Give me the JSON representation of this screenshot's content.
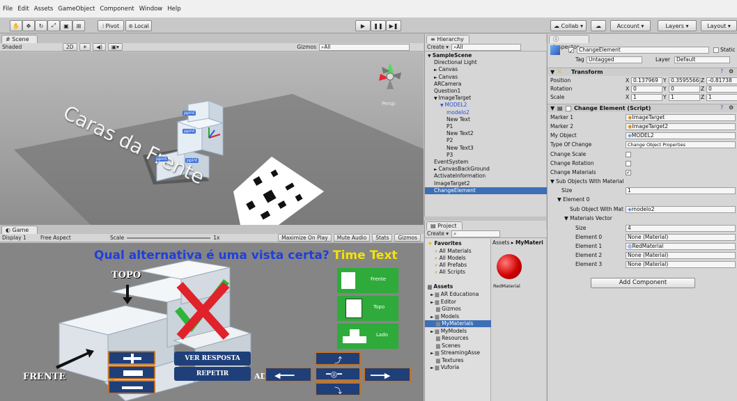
{
  "menu": [
    "File",
    "Edit",
    "Assets",
    "GameObject",
    "Component",
    "Window",
    "Help"
  ],
  "toolbar": {
    "pivot": "Pivot",
    "local": "Local",
    "collab": "Collab",
    "account": "Account",
    "layers": "Layers",
    "layout": "Layout"
  },
  "scene": {
    "tab": "Scene",
    "shading": "Shaded",
    "mode2d": "2D",
    "gizmos": "Gizmos",
    "search": "All",
    "persp": "Persp",
    "world_text": "Caras da Frente",
    "labels": [
      "ppint",
      "ppint",
      "ppint",
      "ppint"
    ]
  },
  "game": {
    "tab": "Game",
    "display": "Display 1",
    "aspect": "Free Aspect",
    "scale_label": "Scale",
    "scale_value": "1x",
    "options": [
      "Maximize On Play",
      "Mute Audio",
      "Stats",
      "Gizmos"
    ],
    "question": "Qual alternativa é uma vista certa?",
    "timer": "Time Text",
    "topo": "TOPO",
    "frente": "FRENTE",
    "partial_label": "AD",
    "ver_resposta": "VER RESPOSTA",
    "repetir": "REPETIR",
    "options_side": [
      "Frente",
      "Topo",
      "Lado"
    ]
  },
  "hierarchy": {
    "tab": "Hierarchy",
    "create": "Create",
    "search": "All",
    "items": [
      {
        "label": "SampleScene",
        "indent": 0,
        "bold": true,
        "arrow": "▼"
      },
      {
        "label": "Directional Light",
        "indent": 1
      },
      {
        "label": "Canvas",
        "indent": 1,
        "arrow": "►"
      },
      {
        "label": "Canvas",
        "indent": 1,
        "arrow": "►"
      },
      {
        "label": "ARCamera",
        "indent": 1
      },
      {
        "label": "Question1",
        "indent": 1
      },
      {
        "label": "ImageTarget",
        "indent": 1,
        "arrow": "▼"
      },
      {
        "label": "MODEL2",
        "indent": 2,
        "arrow": "▼",
        "blue": true
      },
      {
        "label": "modelo2",
        "indent": 3,
        "blue": true
      },
      {
        "label": "New Text",
        "indent": 3
      },
      {
        "label": "P1",
        "indent": 3
      },
      {
        "label": "New Text2",
        "indent": 3
      },
      {
        "label": "P2",
        "indent": 3
      },
      {
        "label": "New Text3",
        "indent": 3
      },
      {
        "label": "P3",
        "indent": 3
      },
      {
        "label": "EventSystem",
        "indent": 1
      },
      {
        "label": "CanvasBackGround",
        "indent": 1,
        "arrow": "►"
      },
      {
        "label": "ActivateInformation",
        "indent": 1
      },
      {
        "label": "ImageTarget2",
        "indent": 1
      },
      {
        "label": "ChangeElement",
        "indent": 1,
        "selected": true
      }
    ]
  },
  "project": {
    "tab": "Project",
    "create": "Create",
    "breadcrumb": [
      "Assets",
      "MyMateri"
    ],
    "favorites_label": "Favorites",
    "favorites": [
      "All Materials",
      "All Models",
      "All Prefabs",
      "All Scripts"
    ],
    "assets_label": "Assets",
    "folders": [
      {
        "label": "AR Educationa",
        "arrow": true
      },
      {
        "label": "Editor",
        "arrow": true
      },
      {
        "label": "Gizmos",
        "arrow": false
      },
      {
        "label": "Models",
        "arrow": true
      },
      {
        "label": "MyMaterials",
        "arrow": false,
        "selected": true
      },
      {
        "label": "MyModels",
        "arrow": true
      },
      {
        "label": "Resources",
        "arrow": false
      },
      {
        "label": "Scenes",
        "arrow": false
      },
      {
        "label": "StreamingAsse",
        "arrow": true
      },
      {
        "label": "Textures",
        "arrow": false
      },
      {
        "label": "Vuforia",
        "arrow": true
      }
    ],
    "asset_name": "RedMaterial"
  },
  "inspector": {
    "tab": "Inspector",
    "object_name": "ChangeElement",
    "static_label": "Static",
    "tag_label": "Tag",
    "tag": "Untagged",
    "layer_label": "Layer",
    "layer": "Default",
    "transform": {
      "title": "Transform",
      "position_label": "Position",
      "rotation_label": "Rotation",
      "scale_label": "Scale",
      "position": [
        "0.137969",
        "0.3595566",
        "-0.81738"
      ],
      "rotation": [
        "0",
        "0",
        "0"
      ],
      "scale": [
        "1",
        "1",
        "1"
      ]
    },
    "script": {
      "title": "Change Element (Script)",
      "marker1_label": "Marker 1",
      "marker1": "ImageTarget",
      "marker2_label": "Marker 2",
      "marker2": "ImageTarget2",
      "myobject_label": "My Object",
      "myobject": "MODEL2",
      "type_label": "Type Of Change",
      "type": "Change Object Properties",
      "change_scale": "Change Scale",
      "change_rotation": "Change Rotation",
      "change_materials": "Change Materials",
      "sub_objects": "Sub Objects With Material",
      "size_label": "Size",
      "size": "1",
      "element0": "Element 0",
      "sub_object_label": "Sub Object With Mat",
      "sub_object": "modelo2",
      "materials_vector": "Materials Vector",
      "mv_size": "4",
      "mv_elements": [
        {
          "label": "Element 0",
          "value": "None (Material)"
        },
        {
          "label": "Element 1",
          "value": "RedMaterial"
        },
        {
          "label": "Element 2",
          "value": "None (Material)"
        },
        {
          "label": "Element 3",
          "value": "None (Material)"
        }
      ]
    },
    "add_component": "Add Component"
  },
  "colors": {
    "question_blue": "#1f3fdc",
    "timer_yellow": "#f4e400",
    "selection_blue": "#3d6fb6",
    "side_button_green": "#2eab3a",
    "game_button_blue": "#1f3f79"
  }
}
